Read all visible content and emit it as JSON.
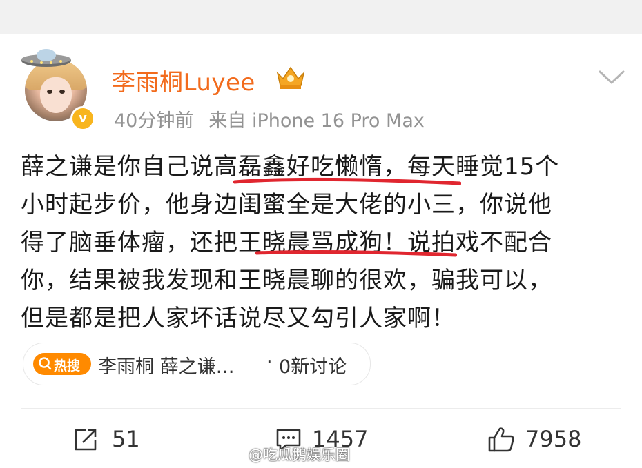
{
  "post": {
    "username": "李雨桐Luyee",
    "time": "40分钟前",
    "source": "来自 iPhone 16 Pro Max",
    "content_lines": [
      "薛之谦是你自己说高磊鑫好吃懒惰，每天睡觉15个",
      "小时起步价，他身边闺蜜全是大佬的小三，你说他",
      "得了脑垂体瘤，还把王晓晨骂成狗！说拍戏不配合",
      "你，结果被我发现和王晓晨聊的很欢，骗我可以，",
      "但是都是把人家坏话说尽又勾引人家啊！"
    ]
  },
  "hot_search": {
    "badge_label": "热搜",
    "topic": "李雨桐 薛之谦…",
    "separator": "·",
    "discussion": "0新讨论"
  },
  "actions": {
    "repost_count": "51",
    "comment_count": "1457",
    "like_count": "7958"
  },
  "watermark": {
    "text": "@吃瓜鹅娱乐圈"
  },
  "colors": {
    "username": "#f26b1d",
    "meta": "#939393",
    "underline": "#e0262f",
    "hot_badge": "#ff8a00",
    "verified": "#f8b51e"
  },
  "icons": {
    "verified": "verified-v-icon",
    "member_badge": "vip-crown-icon",
    "more": "chevron-down-icon",
    "repost": "repost-icon",
    "comment": "comment-icon",
    "like": "thumbs-up-icon",
    "search": "search-icon"
  }
}
